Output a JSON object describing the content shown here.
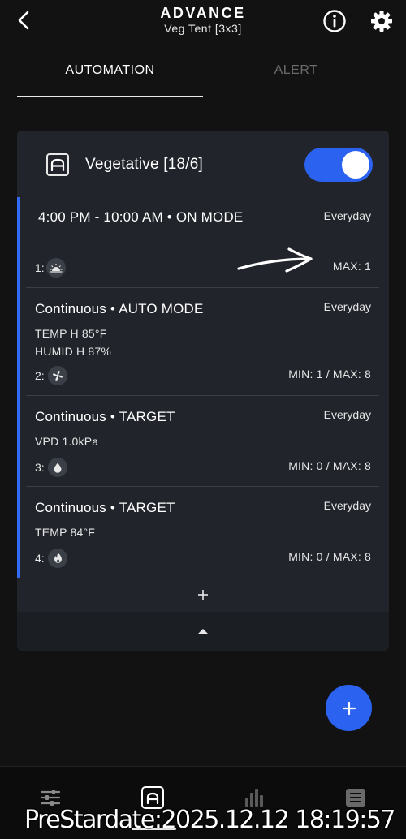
{
  "header": {
    "title": "ADVANCE",
    "subtitle": "Veg Tent [3x3]",
    "back_icon": "chevron-left-icon",
    "info_icon": "info-icon",
    "settings_icon": "gear-icon"
  },
  "tabs": [
    {
      "label": "AUTOMATION",
      "active": true
    },
    {
      "label": "ALERT",
      "active": false
    }
  ],
  "mode": {
    "name": "Vegetative [18/6]",
    "enabled": true,
    "icon": "automation-mode-icon"
  },
  "rules": [
    {
      "title": "4:00 PM - 10:00 AM • ON MODE",
      "schedule": "Everyday",
      "details": [],
      "index": "1:",
      "device_icon": "grow-light-icon",
      "range": "MAX:  1"
    },
    {
      "title": "Continuous • AUTO MODE",
      "schedule": "Everyday",
      "details": [
        "TEMP H 85°F",
        "HUMID H 87%"
      ],
      "index": "2:",
      "device_icon": "fan-icon",
      "range": "MIN: 1 / MAX: 8"
    },
    {
      "title": "Continuous • TARGET",
      "schedule": "Everyday",
      "details": [
        "VPD 1.0kPa"
      ],
      "index": "3:",
      "device_icon": "water-drop-icon",
      "range": "MIN: 0 / MAX: 8"
    },
    {
      "title": "Continuous • TARGET",
      "schedule": "Everyday",
      "details": [
        "TEMP 84°F"
      ],
      "index": "4:",
      "device_icon": "flame-icon",
      "range": "MIN: 0 / MAX: 8"
    }
  ],
  "add_rule_icon": "plus-icon",
  "collapse_icon": "caret-up-icon",
  "fab_icon": "plus-icon",
  "bottom_nav": [
    {
      "icon": "sliders-icon",
      "active": false
    },
    {
      "icon": "automation-icon",
      "active": true
    },
    {
      "icon": "bar-chart-icon",
      "active": false
    },
    {
      "icon": "list-icon",
      "active": false
    }
  ],
  "watermark": "PreStardate:2025.12.12 18:19:57",
  "colors": {
    "accent": "#2b63f0",
    "background": "#121212",
    "card": "#21252b",
    "rule_bar": "#2f6bf3"
  }
}
